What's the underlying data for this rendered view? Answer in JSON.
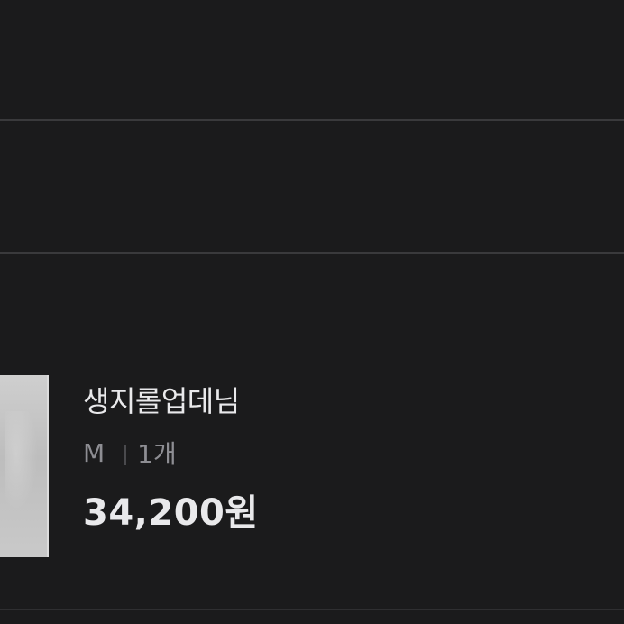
{
  "item": {
    "name": "생지롤업데님",
    "size": "M",
    "quantity": "1개",
    "price": "34,200원"
  }
}
